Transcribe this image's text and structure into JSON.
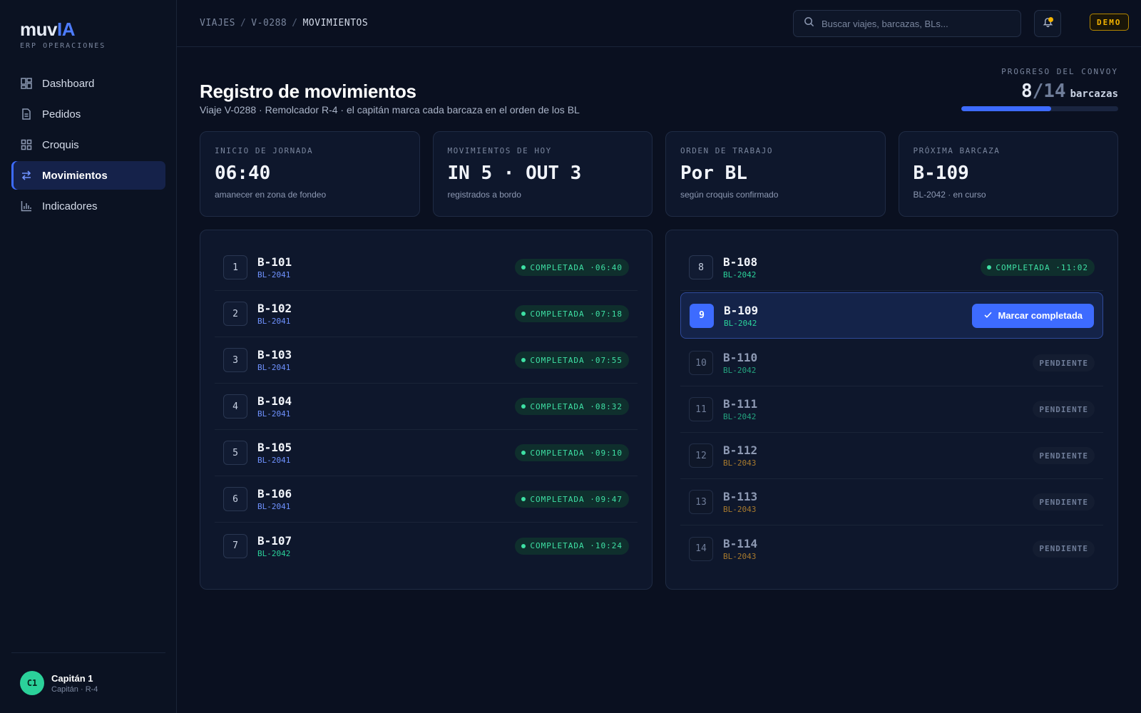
{
  "brand": {
    "name": "muv",
    "accent": "IA",
    "subtitle": "ERP OPERACIONES"
  },
  "nav": [
    {
      "id": "dashboard",
      "label": "Dashboard",
      "icon": "dashboard-icon"
    },
    {
      "id": "pedidos",
      "label": "Pedidos",
      "icon": "document-icon"
    },
    {
      "id": "croquis",
      "label": "Croquis",
      "icon": "grid-icon"
    },
    {
      "id": "movimientos",
      "label": "Movimientos",
      "icon": "swap-icon",
      "active": true
    },
    {
      "id": "indicadores",
      "label": "Indicadores",
      "icon": "bar-chart-icon"
    }
  ],
  "user": {
    "initials": "C1",
    "name": "Capitán 1",
    "role": "Capitán · R-4"
  },
  "breadcrumb": [
    "VIAJES",
    "V-0288",
    "MOVIMIENTOS"
  ],
  "search": {
    "placeholder": "Buscar viajes, barcazas, BLs..."
  },
  "badge": "DEMO",
  "header": {
    "title": "Registro de movimientos",
    "subtitle": "Viaje V-0288 · Remolcador R-4 · el capitán marca cada barcaza en el orden de los BL"
  },
  "progress": {
    "label": "PROGRESO DEL CONVOY",
    "done": "8",
    "total": "/14",
    "unit": "barcazas",
    "fraction": 0.5714
  },
  "stats": [
    {
      "label": "INICIO DE JORNADA",
      "value": "06:40",
      "hint": "amanecer en zona de fondeo"
    },
    {
      "label": "MOVIMIENTOS DE HOY",
      "value": "IN 5 · OUT 3",
      "hint": "registrados a bordo"
    },
    {
      "label": "ORDEN DE TRABAJO",
      "value": "Por BL",
      "hint": "según croquis confirmado"
    },
    {
      "label": "PRÓXIMA BARCAZA",
      "value": "B-109",
      "hint": "BL-2042 · en curso"
    }
  ],
  "status_done_prefix": "COMPLETADA · ",
  "status_pending": "PENDIENTE",
  "mark_button": "Marcar completada",
  "colors": {
    "accent": "#3d6bff",
    "done": "#3ee0a4",
    "bl2041": "#6f92ff",
    "bl2042": "#2bd19a",
    "bl2043": "#d99a2e"
  },
  "barges": [
    {
      "n": "1",
      "barge": "B-101",
      "bl": "BL-2041",
      "state": "done",
      "time": "06:40"
    },
    {
      "n": "2",
      "barge": "B-102",
      "bl": "BL-2041",
      "state": "done",
      "time": "07:18"
    },
    {
      "n": "3",
      "barge": "B-103",
      "bl": "BL-2041",
      "state": "done",
      "time": "07:55"
    },
    {
      "n": "4",
      "barge": "B-104",
      "bl": "BL-2041",
      "state": "done",
      "time": "08:32"
    },
    {
      "n": "5",
      "barge": "B-105",
      "bl": "BL-2041",
      "state": "done",
      "time": "09:10"
    },
    {
      "n": "6",
      "barge": "B-106",
      "bl": "BL-2041",
      "state": "done",
      "time": "09:47"
    },
    {
      "n": "7",
      "barge": "B-107",
      "bl": "BL-2042",
      "state": "done",
      "time": "10:24"
    },
    {
      "n": "8",
      "barge": "B-108",
      "bl": "BL-2042",
      "state": "done",
      "time": "11:02"
    },
    {
      "n": "9",
      "barge": "B-109",
      "bl": "BL-2042",
      "state": "current",
      "time": ""
    },
    {
      "n": "10",
      "barge": "B-110",
      "bl": "BL-2042",
      "state": "pending",
      "time": ""
    },
    {
      "n": "11",
      "barge": "B-111",
      "bl": "BL-2042",
      "state": "pending",
      "time": ""
    },
    {
      "n": "12",
      "barge": "B-112",
      "bl": "BL-2043",
      "state": "pending",
      "time": ""
    },
    {
      "n": "13",
      "barge": "B-113",
      "bl": "BL-2043",
      "state": "pending",
      "time": ""
    },
    {
      "n": "14",
      "barge": "B-114",
      "bl": "BL-2043",
      "state": "pending",
      "time": ""
    }
  ]
}
